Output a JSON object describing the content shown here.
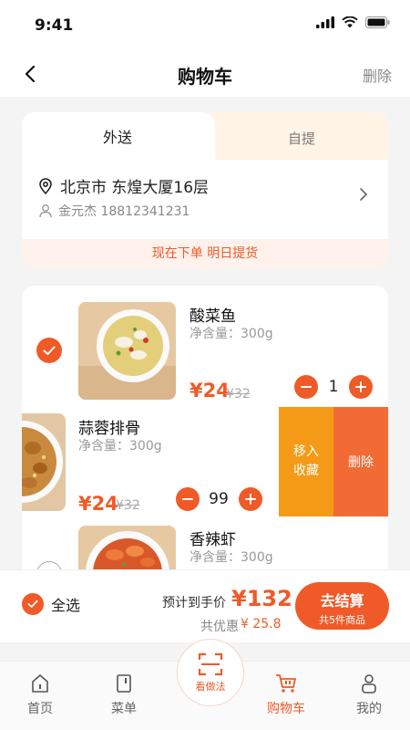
{
  "status": {
    "time": "9:41"
  },
  "nav": {
    "title": "购物车",
    "delete": "删除"
  },
  "delivery": {
    "tabs": [
      "外送",
      "自提"
    ],
    "address": "北京市 东煌大厦16层",
    "contact": "金元杰 18812341231",
    "notice": "现在下单 明日提货"
  },
  "items": [
    {
      "name": "酸菜鱼",
      "spec": "净含量：300g",
      "price": "¥24",
      "old_price": "¥32",
      "qty": "1"
    },
    {
      "name": "蒜蓉排骨",
      "spec": "净含量：300g",
      "price": "¥24",
      "old_price": "¥32",
      "qty": "99"
    },
    {
      "name": "香辣虾",
      "spec": "净含量：300g"
    }
  ],
  "swipe": {
    "favorite": [
      "移入",
      "收藏"
    ],
    "delete": "删除"
  },
  "summary": {
    "select_all": "全选",
    "estimate_label": "预计到手价",
    "estimate_value": "¥132",
    "discount_label": "共优惠",
    "discount_value": "¥ 25.8",
    "checkout": "去结算",
    "checkout_sub": "共5件商品"
  },
  "tabbar": {
    "items": [
      "首页",
      "菜单",
      "购物车",
      "我的"
    ],
    "center": "看做法"
  },
  "colors": {
    "accent": "#ef5a28",
    "favorite": "#f59a16"
  }
}
